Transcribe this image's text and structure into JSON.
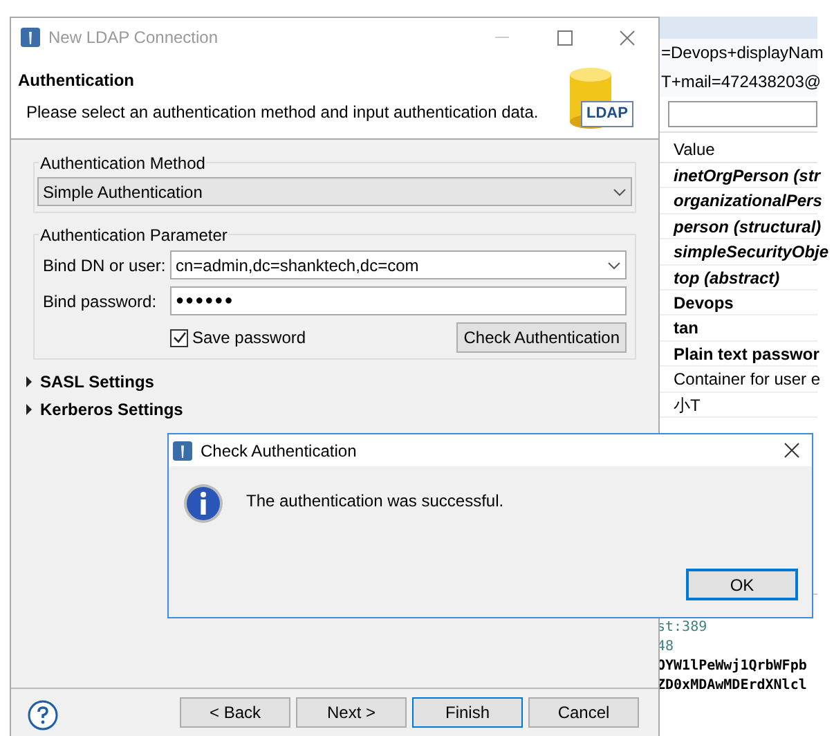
{
  "background_app": {
    "header_lines": [
      "=Devops+displayNam",
      "T+mail=472438203@"
    ],
    "table": {
      "column_header": "Value",
      "rows": [
        {
          "text": "inetOrgPerson (str",
          "kind": "objectclass"
        },
        {
          "text": "organizationalPers",
          "kind": "objectclass"
        },
        {
          "text": "person (structural)",
          "kind": "objectclass"
        },
        {
          "text": "simpleSecurityObje",
          "kind": "objectclass"
        },
        {
          "text": "top (abstract)",
          "kind": "objectclass"
        },
        {
          "text": "Devops",
          "kind": "bold"
        },
        {
          "text": "tan",
          "kind": "bold"
        },
        {
          "text": "Plain text passwor",
          "kind": "bold"
        },
        {
          "text": "Container for user e",
          "kind": "plain"
        },
        {
          "text": "小T",
          "kind": "plain"
        }
      ]
    },
    "code_lines": [
      {
        "text": "st:389",
        "kind": "value"
      },
      {
        "text": "48",
        "kind": "value"
      },
      {
        "text": "OYW1lPeWwj1QrbWFpb",
        "kind": "data"
      },
      {
        "text": "ZD0xMDAwMDErdXNlcl",
        "kind": "data"
      }
    ]
  },
  "window": {
    "title": "New LDAP Connection",
    "active": false,
    "header": {
      "title": "Authentication",
      "description": "Please select an authentication method and input authentication data.",
      "logo_label": "LDAP"
    },
    "method_group": {
      "title": "Authentication Method",
      "value": "Simple Authentication"
    },
    "parameter_group": {
      "title": "Authentication Parameter",
      "bind_dn_label": "Bind DN or user:",
      "bind_dn_value": "cn=admin,dc=shanktech,dc=com",
      "password_label": "Bind password:",
      "password_value": "●●●●●●",
      "save_password": {
        "label": "Save password",
        "checked": true
      },
      "check_button": "Check Authentication"
    },
    "sections": [
      {
        "label": "SASL Settings",
        "expanded": false
      },
      {
        "label": "Kerberos Settings",
        "expanded": false
      }
    ],
    "buttons": [
      {
        "label": "< Back",
        "default": false
      },
      {
        "label": "Next >",
        "default": false
      },
      {
        "label": "Finish",
        "default": true
      },
      {
        "label": "Cancel",
        "default": false
      }
    ]
  },
  "message_dialog": {
    "title": "Check Authentication",
    "active": true,
    "message": "The authentication was successful.",
    "button": "OK"
  }
}
